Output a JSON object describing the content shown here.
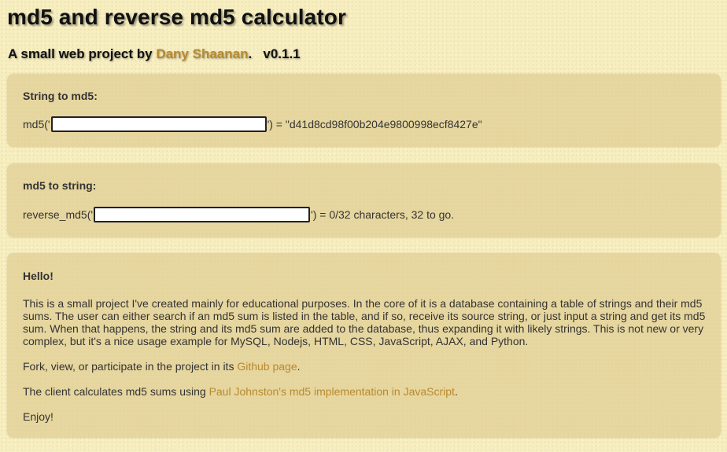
{
  "header": {
    "title": "md5 and reverse md5 calculator",
    "subtitle_prefix": "A small web project by ",
    "author_link": "Dany Shaanan",
    "subtitle_suffix": ".   v0.1.1"
  },
  "string_to_md5": {
    "title": "String to md5:",
    "prefix": "md5('",
    "input_value": "",
    "suffix": "') = \"d41d8cd98f00b204e9800998ecf8427e\""
  },
  "md5_to_string": {
    "title": "md5 to string:",
    "prefix": "reverse_md5('",
    "input_value": "",
    "suffix": "') = 0/32 characters, 32 to go."
  },
  "hello": {
    "title": "Hello!",
    "intro": "This is a small project I've created mainly for educational purposes. In the core of it is a database containing a table of strings and their md5 sums. The user can either search if an md5 sum is listed in the table, and if so, receive its source string, or just input a string and get its md5 sum. When that happens, the string and its md5 sum are added to the database, thus expanding it with likely strings. This is not new or very complex, but it's a nice usage example for MySQL, Nodejs, HTML, CSS, JavaScript, AJAX, and Python.",
    "fork_prefix": "Fork, view, or participate in the project in its ",
    "fork_link": "Github page",
    "fork_suffix": ".",
    "client_prefix": "The client calculates md5 sums using ",
    "client_link": "Paul Johnston's md5 implementation in JavaScript",
    "client_suffix": ".",
    "enjoy": "Enjoy!"
  },
  "colors": {
    "background": "#f7eec0",
    "panel": "#e2d096",
    "link": "#b8892e",
    "text": "#333333"
  }
}
